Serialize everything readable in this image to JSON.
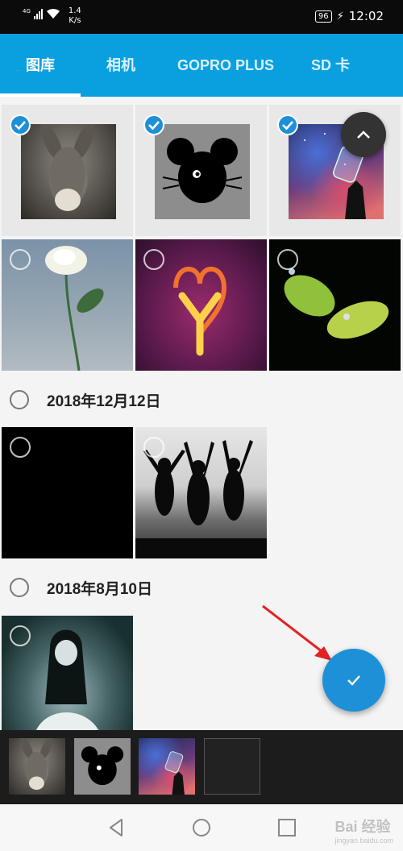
{
  "status_bar": {
    "network": "4G",
    "speed_value": "1.4",
    "speed_unit": "K/s",
    "battery": "96",
    "time": "12:02"
  },
  "tabs": [
    {
      "label": "图库",
      "active": true
    },
    {
      "label": "相机",
      "active": false
    },
    {
      "label": "GOPRO PLUS",
      "active": false
    },
    {
      "label": "SD 卡",
      "active": false
    }
  ],
  "gallery": {
    "groups": [
      {
        "date": "2018年12月12日"
      },
      {
        "date": "2018年8月10日"
      }
    ],
    "thumbnails": [
      {
        "name": "donkey",
        "selected": true
      },
      {
        "name": "mouse",
        "selected": true
      },
      {
        "name": "galaxy-jar",
        "selected": true
      },
      {
        "name": "white-rose",
        "selected": false
      },
      {
        "name": "fire-heart",
        "selected": false
      },
      {
        "name": "green-leaves",
        "selected": false
      },
      {
        "name": "black-image",
        "selected": false
      },
      {
        "name": "silhouettes",
        "selected": false
      },
      {
        "name": "ghost-girl",
        "selected": false
      }
    ]
  },
  "tray": {
    "selected_count": 3,
    "items": [
      "donkey",
      "mouse",
      "galaxy-jar"
    ]
  },
  "icons": {
    "scroll_top": "chevron-up-icon",
    "confirm": "check-icon",
    "nav": [
      "back-icon",
      "home-icon",
      "recents-icon"
    ]
  },
  "watermark": {
    "text": "Bai 经验",
    "sub": "jingyan.baidu.com"
  },
  "colors": {
    "accent": "#0aa0e0",
    "check": "#1e90d8",
    "tray": "#1c1c1c"
  }
}
